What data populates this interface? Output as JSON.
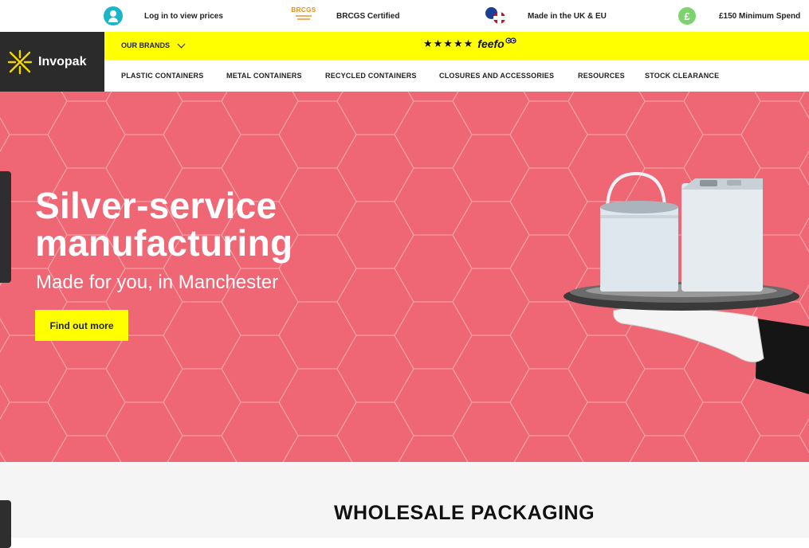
{
  "topbar": {
    "login_label": "Log in to view prices",
    "brcgs_logo_text": "BRCGS",
    "brcgs_label": "BRCGS Certified",
    "made_label": "Made in the UK & EU",
    "pound_symbol": "£",
    "min_spend_label": "£150 Minimum Spend"
  },
  "logo": {
    "text": "Invopak"
  },
  "brandbar": {
    "brands_label": "OUR BRANDS",
    "rating_stars": "★★★★★",
    "feefo_text": "feefo"
  },
  "nav": {
    "items": [
      "PLASTIC CONTAINERS",
      "METAL CONTAINERS",
      "RECYCLED CONTAINERS",
      "CLOSURES AND ACCESSORIES",
      "RESOURCES",
      "STOCK CLEARANCE"
    ]
  },
  "hero": {
    "title_line1": "Silver-service",
    "title_line2": "manufacturing",
    "subtitle": "Made for you, in Manchester",
    "cta_label": "Find out more"
  },
  "section": {
    "title": "WHOLESALE PACKAGING"
  },
  "colors": {
    "hero_bg": "#ef6674",
    "accent_yellow": "#ffff00",
    "logo_bg": "#2b2b2b",
    "user_icon": "#19b6c8",
    "pound_icon": "#7bd36c"
  }
}
